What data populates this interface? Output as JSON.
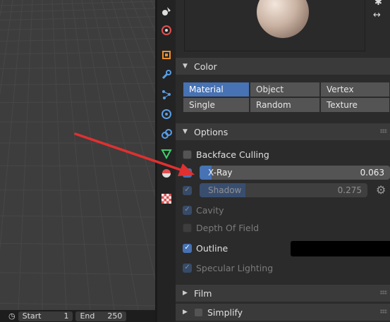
{
  "timeline": {
    "start_label": "Start",
    "start_value": "1",
    "end_label": "End",
    "end_value": "250"
  },
  "sections": {
    "color": {
      "title": "Color"
    },
    "options": {
      "title": "Options"
    },
    "film": {
      "title": "Film"
    },
    "simplify": {
      "title": "Simplify"
    }
  },
  "color_modes": {
    "row1": [
      "Material",
      "Object",
      "Vertex"
    ],
    "row2": [
      "Single",
      "Random",
      "Texture"
    ],
    "active": "Material"
  },
  "options": {
    "backface_culling": "Backface Culling",
    "xray_label": "X-Ray",
    "xray_value": "0.063",
    "xray_fraction": 0.063,
    "shadow_label": "Shadow",
    "shadow_value": "0.275",
    "shadow_fraction": 0.275,
    "cavity": "Cavity",
    "depth_of_field": "Depth Of Field",
    "outline": "Outline",
    "outline_color": "#000000",
    "specular_lighting": "Specular Lighting"
  },
  "colors": {
    "accent": "#4772b3",
    "annotation_arrow": "#e03030"
  }
}
